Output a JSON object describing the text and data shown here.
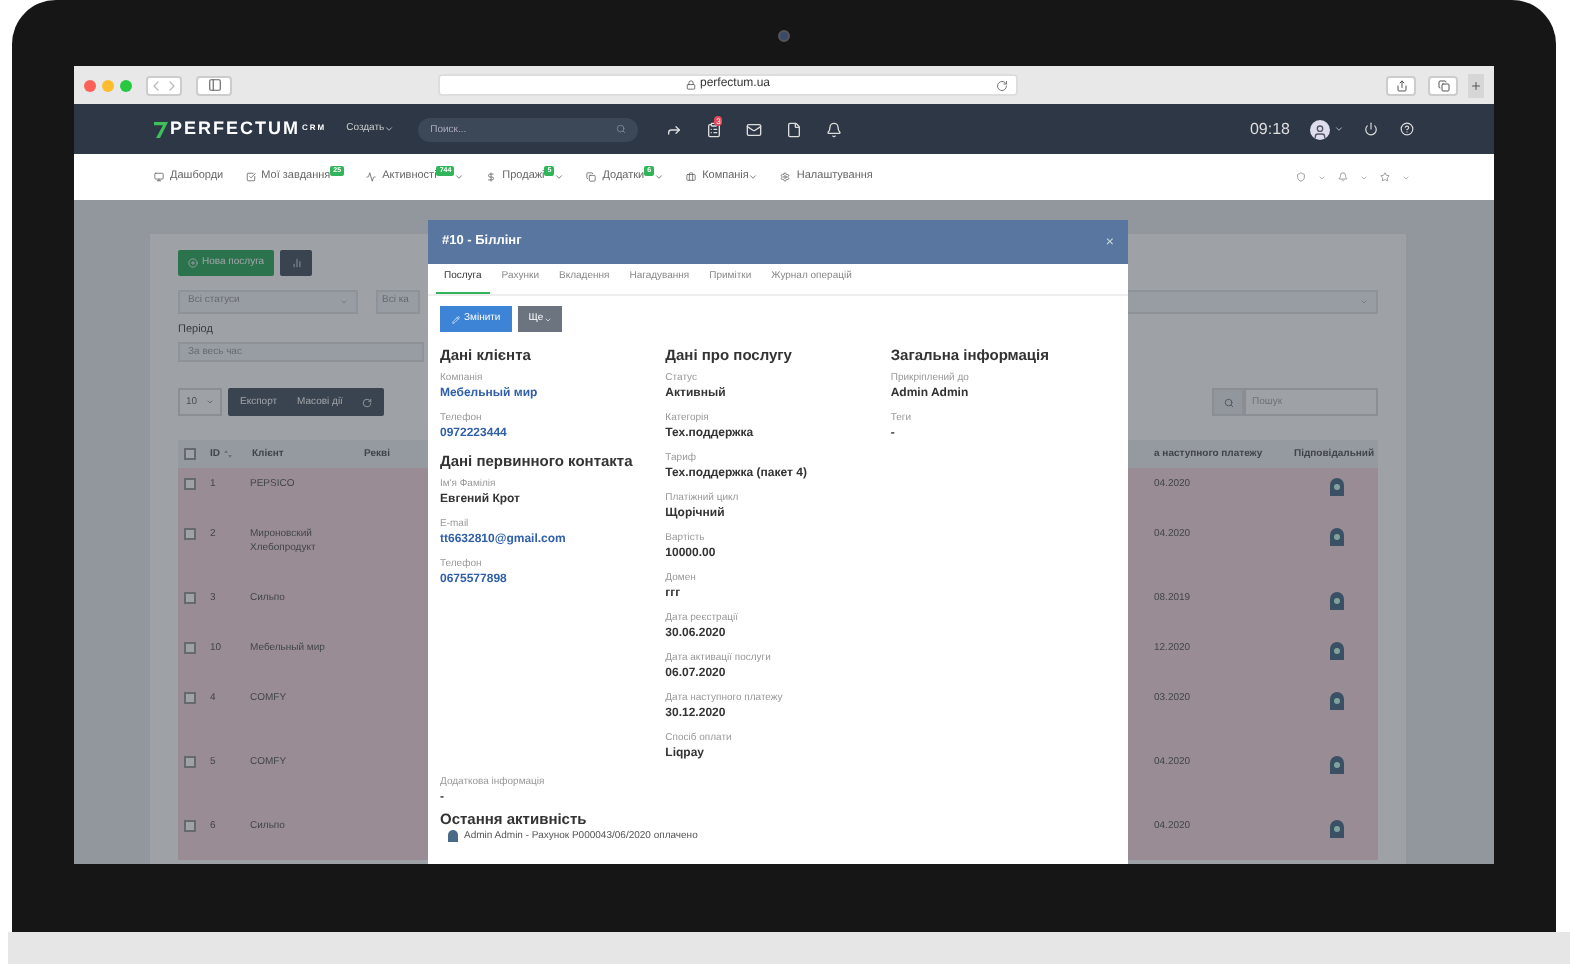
{
  "browser": {
    "url": "perfectum.ua"
  },
  "header": {
    "logo": "PERFECTUM",
    "logo_suffix": "CRM",
    "create": "Создать",
    "search_placeholder": "Поиск...",
    "tasks_badge": "3",
    "time": "09:18"
  },
  "nav": [
    {
      "label": "Дашборди",
      "dropdown": false
    },
    {
      "label": "Мої завдання",
      "badge": "25",
      "dropdown": false
    },
    {
      "label": "Активності",
      "badge": "744",
      "dropdown": true
    },
    {
      "label": "Продажі",
      "badge": "5",
      "dropdown": true
    },
    {
      "label": "Додатки",
      "badge": "6",
      "dropdown": true
    },
    {
      "label": "Компанія",
      "dropdown": true
    },
    {
      "label": "Налаштування",
      "dropdown": false
    }
  ],
  "page": {
    "new_button": "Нова послуга",
    "status_filter": "Всі статуси",
    "category_filter": "Всі ка",
    "period_label": "Період",
    "period_value": "За весь час",
    "page_size": "10",
    "export": "Експорт",
    "bulk": "Масові дії",
    "search_placeholder": "Пошук",
    "select_all_checked": false,
    "columns": [
      "ID",
      "Клієнт",
      "Рекві",
      "а наступного платежу",
      "Підповідальний"
    ],
    "rows": [
      {
        "id": "1",
        "client": "PEPSICO",
        "date": "04.2020",
        "checked": false
      },
      {
        "id": "2",
        "client": "Мироновский Хлебопродукт",
        "date": "04.2020",
        "checked": false
      },
      {
        "id": "3",
        "client": "Сильпо",
        "date": "08.2019",
        "checked": false
      },
      {
        "id": "10",
        "client": "Мебельный мир",
        "date": "12.2020",
        "checked": false
      },
      {
        "id": "4",
        "client": "COMFY",
        "date": "03.2020",
        "checked": false
      },
      {
        "id": "5",
        "client": "COMFY",
        "date": "04.2020",
        "checked": false
      },
      {
        "id": "6",
        "client": "Сильпо",
        "date": "04.2020",
        "checked": false
      }
    ]
  },
  "modal": {
    "title": "#10 - Біллінг",
    "close": "×",
    "tabs": [
      {
        "label": "Послуга",
        "selected": true
      },
      {
        "label": "Рахунки",
        "selected": false
      },
      {
        "label": "Вкладення",
        "selected": false
      },
      {
        "label": "Нагадування",
        "selected": false
      },
      {
        "label": "Примітки",
        "selected": false
      },
      {
        "label": "Журнал операцій",
        "selected": false
      }
    ],
    "edit_button": "Змінити",
    "more_button": "Ще",
    "columns": [
      [
        {
          "heading": "Дані клієнта",
          "fields": [
            {
              "label": "Компанія",
              "value": "Мебельный мир",
              "kind": "link"
            },
            {
              "label": "Телефон",
              "value": "0972223444",
              "kind": "link"
            }
          ]
        },
        {
          "heading": "Дані первинного контакта",
          "fields": [
            {
              "label": "Ім'я Фамілія",
              "value": "Евгений Крот",
              "kind": "text"
            },
            {
              "label": "E-mail",
              "value": "tt6632810@gmail.com",
              "kind": "link"
            },
            {
              "label": "Телефон",
              "value": "0675577898",
              "kind": "link"
            }
          ]
        }
      ],
      [
        {
          "heading": "Дані про послугу",
          "fields": [
            {
              "label": "Статус",
              "value": "Активный",
              "kind": "text"
            },
            {
              "label": "Категорія",
              "value": "Тех.поддержка",
              "kind": "text"
            },
            {
              "label": "Тариф",
              "value": "Тех.поддержка (пакет 4)",
              "kind": "text"
            },
            {
              "label": "Платіжний цикл",
              "value": "Щорічний",
              "kind": "text"
            },
            {
              "label": "Вартість",
              "value": "10000.00",
              "kind": "text"
            },
            {
              "label": "Домен",
              "value": "ггг",
              "kind": "text"
            },
            {
              "label": "Дата реєстрації",
              "value": "30.06.2020",
              "kind": "text"
            },
            {
              "label": "Дата активації послуги",
              "value": "06.07.2020",
              "kind": "text"
            },
            {
              "label": "Дата наступного платежу",
              "value": "30.12.2020",
              "kind": "text"
            },
            {
              "label": "Спосіб оплати",
              "value": "Liqpay",
              "kind": "text"
            }
          ]
        }
      ],
      [
        {
          "heading": "Загальна інформація",
          "fields": [
            {
              "label": "Прикріплений до",
              "value": "Admin Admin",
              "kind": "text"
            },
            {
              "label": "Теги",
              "value": "-",
              "kind": "text"
            }
          ]
        }
      ]
    ],
    "extra": {
      "label": "Додаткова інформація",
      "value": "-"
    },
    "activity_heading": "Остання активність",
    "activity": "Admin Admin - Рахунок P000043/06/2020 оплачено"
  }
}
